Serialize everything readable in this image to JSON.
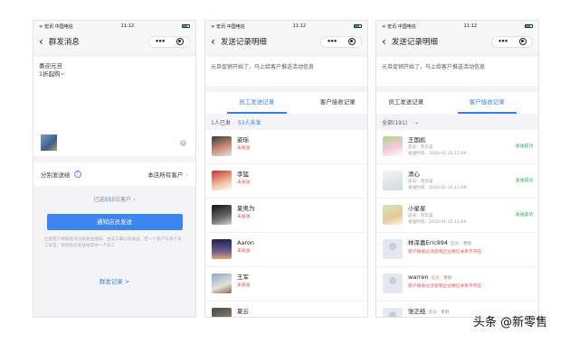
{
  "status": {
    "carrier": "ᯤ 宏讯 中国电信",
    "time": "11:12"
  },
  "phone1": {
    "title": "群发消息",
    "message_lines": [
      "喜迎元旦",
      "1折起购~"
    ],
    "send_label": "分别发送给",
    "send_value": "本店所有客户",
    "selected_prefix": "已选",
    "selected_count": "555",
    "selected_suffix": "位客户",
    "button": "通知店员发送",
    "hint": "已选客户将按店员分别发送通知，由员工确认后发送，若一个客户与多个员工好友，则消息仅发送给其中一个员工",
    "records_link": "群发记录 >"
  },
  "phone2": {
    "title": "发送记录明细",
    "headline": "元旦促销开始了，马上给客户推送活动信息",
    "tabs": [
      "员工发送记录",
      "客户接收记录"
    ],
    "sent": "1人已发",
    "unsent": "53人未发",
    "staff": [
      {
        "name": "姿瑶",
        "status": "未发送"
      },
      {
        "name": "李猛",
        "status": "未发送"
      },
      {
        "name": "夏奥为",
        "status": "未发送"
      },
      {
        "name": "Aaron",
        "status": "未发送"
      },
      {
        "name": "王军",
        "status": "未发送"
      },
      {
        "name": "夏云",
        "status": ""
      }
    ]
  },
  "phone3": {
    "title": "发送记录明细",
    "headline": "元旦促销开始了，马上给客户推送活动信息",
    "tabs": [
      "员工发送记录",
      "客户接收记录"
    ],
    "filter": "全部(191)",
    "customers": [
      {
        "name": "王国彪",
        "store": "店员：刘华美",
        "time": "发送时间：2020-01-15 11:09",
        "status": "发送成功",
        "warn": ""
      },
      {
        "name": "清心",
        "store": "店员：刘华美",
        "time": "发送时间：2020-01-15 11:09",
        "status": "发送成功",
        "warn": ""
      },
      {
        "name": "小星星",
        "store": "店员：刘华美",
        "time": "发送时间：2020-01-15 11:09",
        "status": "发送成功",
        "warn": ""
      },
      {
        "name": "林泽嘉Eric994",
        "store": "店员：曹静",
        "time": "",
        "status": "",
        "warn": "客户接收过消息或企业微信关系不存在"
      },
      {
        "name": "warren",
        "store": "店员：曹静",
        "time": "",
        "status": "",
        "warn": "客户接收过消息或企业微信关系不存在"
      },
      {
        "name": "张正经",
        "store": "店员：曹静",
        "time": "",
        "status": "",
        "warn": ""
      }
    ]
  },
  "watermark": "头条 @新零售",
  "colors": {
    "accent": "#3d86f2",
    "danger": "#e54b4b",
    "success": "#20a84e"
  }
}
